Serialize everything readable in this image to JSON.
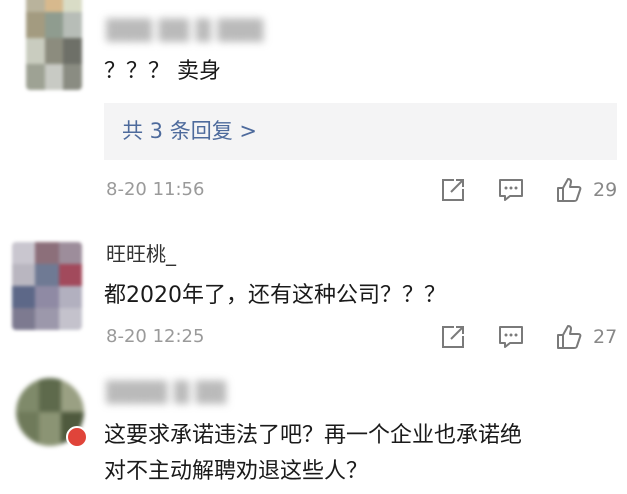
{
  "comments": [
    {
      "username": "▒▒▒ ▒▒ ▒ ▒▒▒",
      "text": "？？？ 卖身",
      "replies_label": "共 3 条回复 >",
      "time": "8-20 11:56",
      "likes": "29",
      "avatar_colors": [
        "#b9b39c",
        "#d7b98d",
        "#d9dcc6",
        "#a39b80",
        "#8f9c8f",
        "#b7bdb7",
        "#c9ccbf",
        "#8c8c7e",
        "#6e7068",
        "#9ea294",
        "#c8cac4",
        "#8a8c82"
      ]
    },
    {
      "username": "旺旺桃_",
      "text": "都2020年了，还有这种公司？？？",
      "time": "8-20 12:25",
      "likes": "27",
      "avatar_colors": [
        "#c9c6cf",
        "#8c6f7a",
        "#9d8d9b",
        "#b9b6c0",
        "#6f7a94",
        "#a24a5c",
        "#5d6888",
        "#8f8aa4",
        "#b2b0bf",
        "#7d7a90",
        "#9c98ab",
        "#c4c2cc"
      ]
    },
    {
      "username": "▒▒▒▒ ▒ ▒▒",
      "text_line1": "这要求承诺违法了吧？再一个企业也承诺绝",
      "text_line2": "对不主动解聘劝退这些人？",
      "avatar_colors": [
        "#7f8a6a",
        "#5e6a4c",
        "#9aa083",
        "#6f7a5a",
        "#8b9474",
        "#4f5a3e"
      ]
    }
  ],
  "icons": {
    "share": "share-icon",
    "comment": "comment-icon",
    "like": "thumbs-up-icon"
  },
  "colors": {
    "link": "#4d6a9c",
    "meta": "#9a9a9a",
    "reply_bg": "#f4f4f5",
    "badge": "#e0443a"
  }
}
